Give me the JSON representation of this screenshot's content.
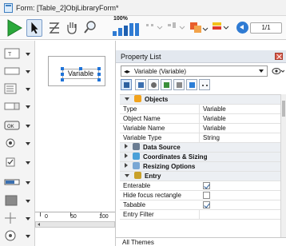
{
  "window": {
    "title": "Form: [Table_2]ObjLibraryForm*"
  },
  "toolbar": {
    "zoom_percent": "100%",
    "page_indicator": "1/1",
    "tools": [
      "run",
      "select-arrow",
      "text-tool",
      "hand-tool",
      "zoom-tool",
      "form-objects",
      "align",
      "distribute",
      "layer",
      "color",
      "page-nav"
    ]
  },
  "palette": {
    "items": [
      "text-area",
      "input-field",
      "list-box",
      "combo-box",
      "button",
      "radio-button",
      "checkbox",
      "progress-bar",
      "rectangle",
      "splitter",
      "web-area"
    ]
  },
  "canvas": {
    "object_label": "Variable",
    "ruler_ticks": [
      "0",
      "50",
      "100"
    ]
  },
  "property_list": {
    "title": "Property List",
    "selected_object": "Variable (Variable)",
    "sections": [
      {
        "name": "Objects",
        "expanded": true
      },
      {
        "name": "Data Source",
        "expanded": false
      },
      {
        "name": "Coordinates & Sizing",
        "expanded": false
      },
      {
        "name": "Resizing Options",
        "expanded": false
      },
      {
        "name": "Entry",
        "expanded": true
      }
    ],
    "objects_rows": [
      {
        "key": "Type",
        "value": "Variable"
      },
      {
        "key": "Object Name",
        "value": "Variable"
      },
      {
        "key": "Variable Name",
        "value": "Variable"
      },
      {
        "key": "Variable Type",
        "value": "String"
      }
    ],
    "entry_rows": [
      {
        "key": "Enterable",
        "checked": true
      },
      {
        "key": "Hide focus rectangle",
        "checked": false
      },
      {
        "key": "Tabable",
        "checked": true
      },
      {
        "key": "Entry Filter",
        "value": ""
      }
    ],
    "themes_label": "All Themes"
  },
  "colors": {
    "accent": "#2f7bd3",
    "play_green": "#2aa83a"
  }
}
